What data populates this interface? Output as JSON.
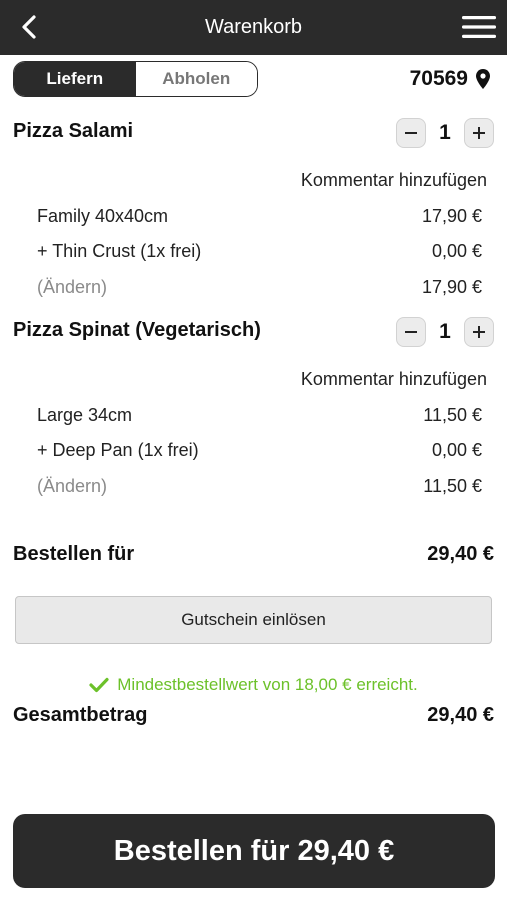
{
  "header": {
    "title": "Warenkorb",
    "back_icon": "chevron-left-icon",
    "menu_icon": "hamburger-menu-icon"
  },
  "delivery_toggle": {
    "options": [
      "Liefern",
      "Abholen"
    ],
    "selected": "Liefern"
  },
  "location": {
    "postcode": "70569",
    "icon": "map-pin-icon"
  },
  "items": [
    {
      "name": "Pizza Salami",
      "quantity": "1",
      "comment_link": "Kommentar hinzufügen",
      "lines": [
        {
          "label": "Family 40x40cm",
          "price": "17,90 €"
        },
        {
          "label": "+ Thin Crust (1x frei)",
          "price": "0,00 €"
        },
        {
          "label": "(Ändern)",
          "price": "17,90 €"
        }
      ]
    },
    {
      "name": "Pizza Spinat (Vegetarisch)",
      "quantity": "1",
      "comment_link": "Kommentar hinzufügen",
      "lines": [
        {
          "label": "Large 34cm",
          "price": "11,50 €"
        },
        {
          "label": "+ Deep Pan (1x frei)",
          "price": "0,00 €"
        },
        {
          "label": "(Ändern)",
          "price": "11,50 €"
        }
      ]
    }
  ],
  "order_for": {
    "label": "Bestellen für",
    "amount": "29,40 €"
  },
  "voucher_button": "Gutschein einlösen",
  "min_order_note": {
    "text": "Mindestbestellwert von 18,00 € erreicht.",
    "icon": "checkmark-icon",
    "color": "#6cc12a"
  },
  "grand_total": {
    "label": "Gesamtbetrag",
    "amount": "29,40 €"
  },
  "order_button": "Bestellen für 29,40 €",
  "colors": {
    "header_bg": "#2b2b2b",
    "accent_green": "#6cc12a"
  }
}
